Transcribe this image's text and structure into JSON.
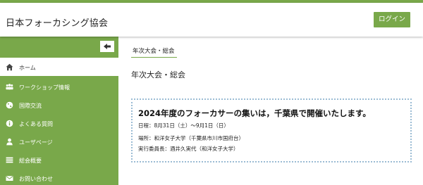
{
  "header": {
    "site_title": "日本フォーカシング協会",
    "login_label": "ログイン"
  },
  "sidebar": {
    "items": [
      {
        "label": "ホーム",
        "icon": "home-icon",
        "active": true
      },
      {
        "label": "ワークショップ情報",
        "icon": "workshop-icon",
        "active": false
      },
      {
        "label": "国際交流",
        "icon": "globe-icon",
        "active": false
      },
      {
        "label": "よくある質問",
        "icon": "info-icon",
        "active": false
      },
      {
        "label": "ユーザページ",
        "icon": "user-icon",
        "active": false
      },
      {
        "label": "総会概要",
        "icon": "list-icon",
        "active": false
      },
      {
        "label": "お問い合わせ",
        "icon": "mail-icon",
        "active": false
      }
    ]
  },
  "main": {
    "breadcrumb": "年次大会・総会",
    "page_title": "年次大会・総会",
    "notice": {
      "heading": "2024年度のフォーカサーの集いは，千葉県で開催いたします。",
      "date": "日程：8月31日（土）〜9月1日（日）",
      "venue": "場所：和洋女子大学（千葉県市川市国府台）",
      "chair": "実行委員長：酒井久実代（和洋女子大学）"
    }
  },
  "colors": {
    "accent": "#79a84a",
    "notice_border": "#9bbcd4"
  }
}
